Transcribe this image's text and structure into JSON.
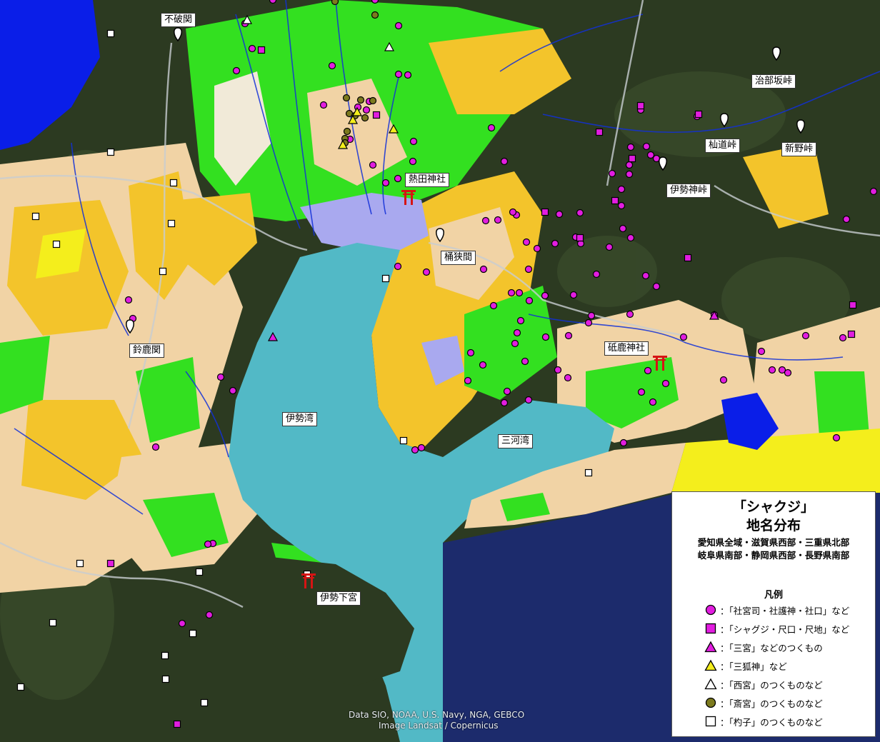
{
  "labels": {
    "fuwa": "不破関",
    "atsuta": "熱田神社",
    "okehazama": "桶狭間",
    "suzuka": "鈴鹿関",
    "isewan": "伊勢湾",
    "mikawawan": "三河湾",
    "toganoo": "砥鹿神社",
    "iseshimo": "伊勢下宮",
    "jibuzaka": "治部坂峠",
    "somadou": "杣道峠",
    "shinno": "新野峠",
    "isegami": "伊勢神峠"
  },
  "attribution": {
    "line1": "Data SIO, NOAA, U.S. Navy, NGA, GEBCO",
    "line2": "Image Landsat / Copernicus"
  },
  "legend": {
    "title1": "「シャクジ」",
    "title2": "地名分布",
    "sub1": "愛知県全域・滋賀県西部・三重県北部",
    "sub2": "岐阜県南部・静岡県西部・長野県南部",
    "heading": "凡例",
    "items": [
      {
        "symbol": "circle-magenta",
        "text": "：「社宮司・社護神・社口」など"
      },
      {
        "symbol": "square-magenta",
        "text": "：「シャグジ・尺口・尺地」など"
      },
      {
        "symbol": "triangle-magenta",
        "text": "：「三宮」などのつくもの"
      },
      {
        "symbol": "triangle-yellow",
        "text": "：「三狐神」など"
      },
      {
        "symbol": "triangle-white",
        "text": "：「西宮」のつくものなど"
      },
      {
        "symbol": "circle-olive",
        "text": "：「斎宮」のつくものなど"
      },
      {
        "symbol": "square-white",
        "text": "：「杓子」のつくものなど"
      }
    ]
  },
  "colors": {
    "magenta": "#e21de0",
    "olive": "#7c7a1e",
    "yellow": "#f4ee1c",
    "bay": "#52b9c6",
    "ocean": "#1b2a6b",
    "lake": "#0b1ee8",
    "forest": "#2b3a20",
    "green": "#32e01e",
    "sand": "#f2d3a5",
    "orange": "#f3c42b",
    "urban": "#a9a9ef",
    "shrine": "#d61414"
  }
}
